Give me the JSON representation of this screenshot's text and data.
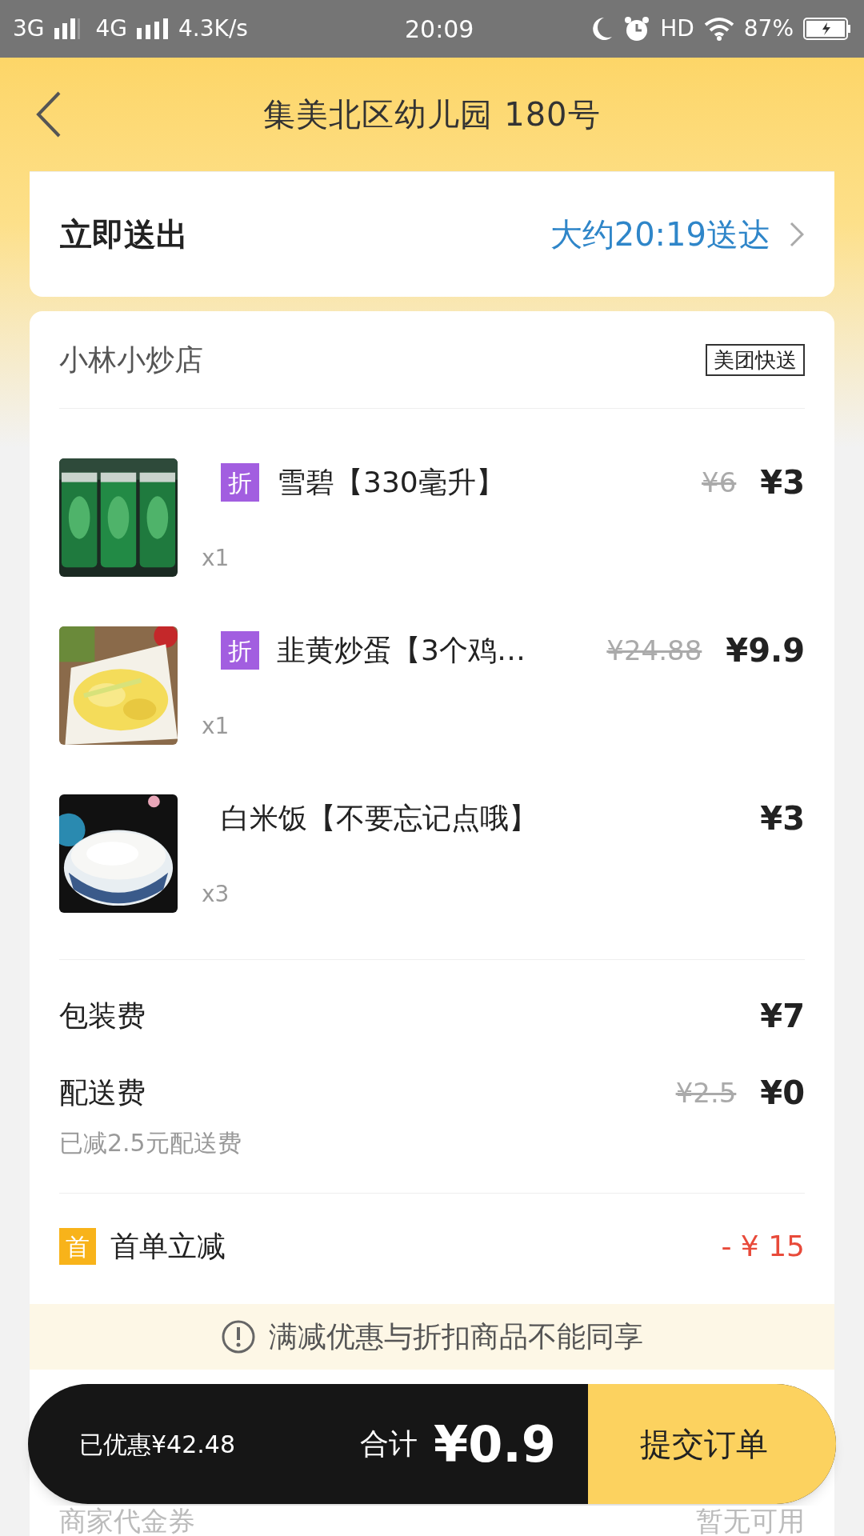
{
  "status_bar": {
    "network_1": "3G",
    "network_2": "4G",
    "speed": "4.3K/s",
    "time": "20:09",
    "hd": "HD",
    "battery": "87%"
  },
  "header": {
    "title": "集美北区幼儿园 180号"
  },
  "delivery": {
    "label": "立即送出",
    "time": "大约20:19送达"
  },
  "shop": {
    "name": "小林小炒店",
    "badge": "美团快送"
  },
  "items": [
    {
      "kind": "drink",
      "tag": "折",
      "name": "雪碧【330毫升】",
      "original_price": "¥6",
      "price": "¥3",
      "quantity": "x1"
    },
    {
      "kind": "eggs",
      "tag": "折",
      "name": "韭黄炒蛋【3个鸡…",
      "original_price": "¥24.88",
      "price": "¥9.9",
      "quantity": "x1"
    },
    {
      "kind": "rice",
      "name": "白米饭【不要忘记点哦】",
      "price": "¥3",
      "quantity": "x3"
    }
  ],
  "fees": [
    {
      "label": "包装费",
      "price": "¥7"
    },
    {
      "label": "配送费",
      "original_price": "¥2.5",
      "price": "¥0",
      "note": "已减2.5元配送费"
    }
  ],
  "promotions": [
    {
      "icon": "首",
      "label": "首单立减",
      "amount": "- ¥ 15"
    }
  ],
  "notice": {
    "text": "满减优惠与折扣商品不能同享"
  },
  "voucher": {
    "label": "商家代金券",
    "value": "暂无可用"
  },
  "checkout": {
    "saved": "已优惠¥42.48",
    "total_label": "合计",
    "total": "¥0.9",
    "submit": "提交订单"
  }
}
